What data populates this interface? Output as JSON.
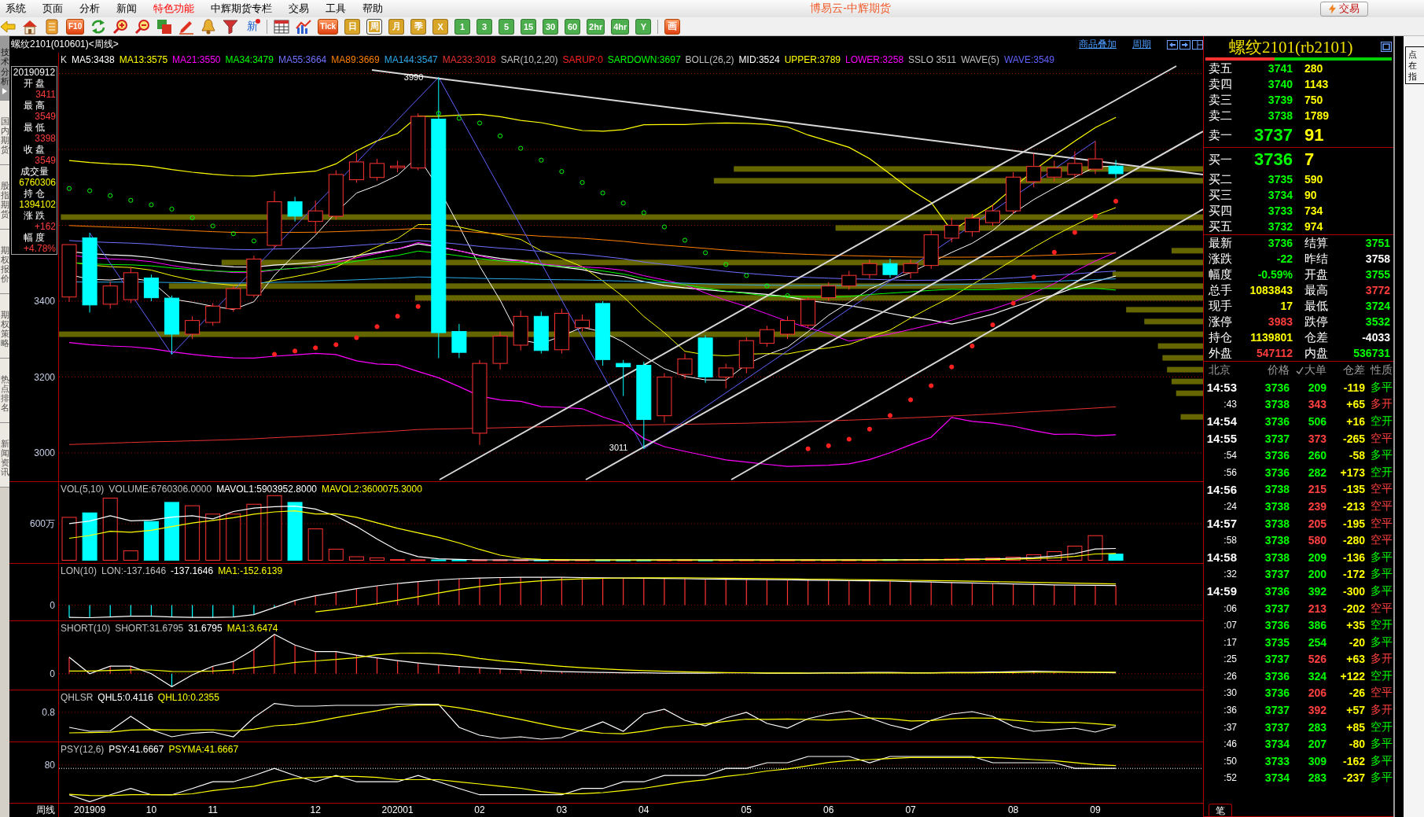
{
  "window": {
    "title": "博易云-中辉期货"
  },
  "menu": [
    {
      "label": "系统",
      "highlighted": false
    },
    {
      "label": "页面",
      "highlighted": false
    },
    {
      "label": "分析",
      "highlighted": false
    },
    {
      "label": "新闻",
      "highlighted": false
    },
    {
      "label": "特色功能",
      "highlighted": true
    },
    {
      "label": "中辉期货专栏",
      "highlighted": false
    },
    {
      "label": "交易",
      "highlighted": false
    },
    {
      "label": "工具",
      "highlighted": false
    },
    {
      "label": "帮助",
      "highlighted": false
    }
  ],
  "trade_button": {
    "label": "交易"
  },
  "toolbar": {
    "f10": "F10",
    "news": "新",
    "tick": "Tick",
    "draw": "画",
    "periods": [
      {
        "label": "日",
        "selected": false,
        "color": "#d8a528"
      },
      {
        "label": "周",
        "selected": true,
        "color": "#d8a528"
      },
      {
        "label": "月",
        "selected": false,
        "color": "#d8a528"
      },
      {
        "label": "季",
        "selected": false,
        "color": "#d8a528"
      },
      {
        "label": "X",
        "selected": false,
        "color": "#d8a528"
      },
      {
        "label": "1",
        "selected": false,
        "color": "#4cae4c"
      },
      {
        "label": "3",
        "selected": false,
        "color": "#4cae4c"
      },
      {
        "label": "5",
        "selected": false,
        "color": "#4cae4c"
      },
      {
        "label": "15",
        "selected": false,
        "color": "#4cae4c"
      },
      {
        "label": "30",
        "selected": false,
        "color": "#4cae4c"
      },
      {
        "label": "60",
        "selected": false,
        "color": "#4cae4c"
      },
      {
        "label": "2hr",
        "selected": false,
        "color": "#4cae4c"
      },
      {
        "label": "4hr",
        "selected": false,
        "color": "#4cae4c"
      },
      {
        "label": "Y",
        "selected": false,
        "color": "#4cae4c"
      }
    ]
  },
  "side_tabs": [
    {
      "label": "技术分析",
      "selected": true
    },
    {
      "label": "国内期货",
      "selected": false
    },
    {
      "label": "股指期货",
      "selected": false
    },
    {
      "label": "期权报价",
      "selected": false
    },
    {
      "label": "期权策略",
      "selected": false
    },
    {
      "label": "热点排名",
      "selected": false
    },
    {
      "label": "新闻资讯",
      "selected": false
    }
  ],
  "chart_header": {
    "title": "螺纹2101(010601)<周线>",
    "links": [
      "商品叠加",
      "周期"
    ]
  },
  "main_chart": {
    "legend": [
      {
        "text": "K",
        "color": "#e0e0e0"
      },
      {
        "text": "MA5:3438",
        "color": "#ffffff"
      },
      {
        "text": "MA13:3575",
        "color": "#ffff00"
      },
      {
        "text": "MA21:3550",
        "color": "#ff00ff"
      },
      {
        "text": "MA34:3479",
        "color": "#00ff00"
      },
      {
        "text": "MA55:3664",
        "color": "#7070ff"
      },
      {
        "text": "MA89:3669",
        "color": "#ff8000"
      },
      {
        "text": "MA144:3547",
        "color": "#2ca8e8"
      },
      {
        "text": "MA233:3018",
        "color": "#e83030"
      },
      {
        "text": "SAR(10,2,20)",
        "color": "#c0c0c0"
      },
      {
        "text": "SARUP:0",
        "color": "#ff2020"
      },
      {
        "text": "SARDOWN:3697",
        "color": "#00ff00"
      },
      {
        "text": "BOLL(26,2)",
        "color": "#c0c0c0"
      },
      {
        "text": "MID:3524",
        "color": "#ffffff"
      },
      {
        "text": "UPPER:3789",
        "color": "#ffff00"
      },
      {
        "text": "LOWER:3258",
        "color": "#ff00ff"
      },
      {
        "text": "SSLO 3511",
        "color": "#c0c0c0"
      },
      {
        "text": "WAVE(5)",
        "color": "#c0c0c0"
      },
      {
        "text": "WAVE:3549",
        "color": "#6060ff"
      }
    ],
    "info": {
      "date": "20190912",
      "fields": [
        {
          "label": "开 盘",
          "value": "3411",
          "color": "#ff3c3c"
        },
        {
          "label": "最 高",
          "value": "3549",
          "color": "#ff3c3c"
        },
        {
          "label": "最 低",
          "value": "3398",
          "color": "#ff3c3c"
        },
        {
          "label": "收 盘",
          "value": "3549",
          "color": "#ff3c3c"
        },
        {
          "label": "成交量",
          "value": "6760306",
          "color": "#ffff00"
        },
        {
          "label": "持 仓",
          "value": "1394102",
          "color": "#ffff00"
        },
        {
          "label": "涨 跌",
          "value": "+162",
          "color": "#ff3c3c"
        },
        {
          "label": "幅 度",
          "value": "+4.78%",
          "color": "#ff3c3c"
        }
      ]
    },
    "y_labels": [
      "3400",
      "3200",
      "3000"
    ],
    "high_mark": "3990",
    "low_mark": "3011"
  },
  "indicator_panes": [
    {
      "kind": "volume",
      "axis_label": "600万",
      "legend": [
        {
          "text": "VOL(5,10)",
          "color": "#c0c0c0"
        },
        {
          "text": "VOLUME:6760306.0000",
          "color": "#c0c0c0"
        },
        {
          "text": "MAVOL1:5903952.8000",
          "color": "#ffffff"
        },
        {
          "text": "MAVOL2:3600075.3000",
          "color": "#ffff00"
        }
      ]
    },
    {
      "kind": "lon",
      "axis_label": "0",
      "legend": [
        {
          "text": "LON(10)",
          "color": "#c0c0c0"
        },
        {
          "text": "LON:-137.1646",
          "color": "#c0c0c0"
        },
        {
          "text": "-137.1646",
          "color": "#ffffff"
        },
        {
          "text": "MA1:-152.6139",
          "color": "#ffff00"
        }
      ]
    },
    {
      "kind": "short",
      "axis_label": "0",
      "legend": [
        {
          "text": "SHORT(10)",
          "color": "#c0c0c0"
        },
        {
          "text": "SHORT:31.6795",
          "color": "#c0c0c0"
        },
        {
          "text": "31.6795",
          "color": "#ffffff"
        },
        {
          "text": "MA1:3.6474",
          "color": "#ffff00"
        }
      ]
    },
    {
      "kind": "qhlsr",
      "axis_label": "0.8",
      "legend": [
        {
          "text": "QHLSR",
          "color": "#c0c0c0"
        },
        {
          "text": "QHL5:0.4116",
          "color": "#ffffff"
        },
        {
          "text": "QHL10:0.2355",
          "color": "#ffff00"
        }
      ]
    },
    {
      "kind": "psy",
      "axis_label": "80",
      "legend": [
        {
          "text": "PSY(12,6)",
          "color": "#c0c0c0"
        },
        {
          "text": "PSY:41.6667",
          "color": "#ffffff"
        },
        {
          "text": "PSYMA:41.6667",
          "color": "#ffff00"
        }
      ]
    }
  ],
  "x_axis": {
    "label": "周线",
    "ticks": [
      "201909",
      "10",
      "11",
      "12",
      "202001",
      "02",
      "03",
      "04",
      "05",
      "06",
      "07",
      "08",
      "09"
    ]
  },
  "quote": {
    "title": "螺纹2101(rb2101)",
    "balance": {
      "level": 0.37
    },
    "asks": [
      {
        "label": "卖五",
        "price": "3741",
        "volume": "280",
        "kind": "level"
      },
      {
        "label": "卖四",
        "price": "3740",
        "volume": "1143",
        "kind": "level"
      },
      {
        "label": "卖三",
        "price": "3739",
        "volume": "750",
        "kind": "level"
      },
      {
        "label": "卖二",
        "price": "3738",
        "volume": "1789",
        "kind": "level"
      },
      {
        "label": "卖一",
        "price": "3737",
        "volume": "91",
        "kind": "best"
      }
    ],
    "bids": [
      {
        "label": "买一",
        "price": "3736",
        "volume": "7",
        "kind": "best"
      },
      {
        "label": "买二",
        "price": "3735",
        "volume": "590",
        "kind": "level"
      },
      {
        "label": "买三",
        "price": "3734",
        "volume": "90",
        "kind": "level"
      },
      {
        "label": "买四",
        "price": "3733",
        "volume": "734",
        "kind": "level"
      },
      {
        "label": "买五",
        "price": "3732",
        "volume": "974",
        "kind": "level"
      }
    ],
    "stats": [
      {
        "left": {
          "label": "最新",
          "value": "3736",
          "color": "#00ff00"
        },
        "right": {
          "label": "结算",
          "value": "3751",
          "color": "#00ff00"
        }
      },
      {
        "left": {
          "label": "涨跌",
          "value": "-22",
          "color": "#00ff00"
        },
        "right": {
          "label": "昨结",
          "value": "3758",
          "color": "#ffffff"
        }
      },
      {
        "left": {
          "label": "幅度",
          "value": "-0.59%",
          "color": "#00ff00"
        },
        "right": {
          "label": "开盘",
          "value": "3755",
          "color": "#00ff00"
        }
      },
      {
        "left": {
          "label": "总手",
          "value": "1083843",
          "color": "#ffff00"
        },
        "right": {
          "label": "最高",
          "value": "3772",
          "color": "#ff3c3c"
        }
      },
      {
        "left": {
          "label": "现手",
          "value": "17",
          "color": "#ffff00"
        },
        "right": {
          "label": "最低",
          "value": "3724",
          "color": "#00ff00"
        }
      },
      {
        "left": {
          "label": "涨停",
          "value": "3983",
          "color": "#ff3c3c"
        },
        "right": {
          "label": "跌停",
          "value": "3532",
          "color": "#00ff00"
        }
      },
      {
        "left": {
          "label": "持仓",
          "value": "1139801",
          "color": "#ffff00"
        },
        "right": {
          "label": "仓差",
          "value": "-4033",
          "color": "#ffffff"
        }
      },
      {
        "left": {
          "label": "外盘",
          "value": "547112",
          "color": "#ff3c3c"
        },
        "right": {
          "label": "内盘",
          "value": "536731",
          "color": "#00ff00"
        }
      }
    ],
    "ticks": {
      "header": [
        "北京",
        "价格",
        "大单",
        "仓差",
        "性质"
      ],
      "rows": [
        {
          "time": "14:53",
          "kind": "minute",
          "price": "3736",
          "volume": "209",
          "change": "-119",
          "type": "多平",
          "color": "#00ff00"
        },
        {
          "time": ":43",
          "kind": "second",
          "price": "3738",
          "volume": "343",
          "change": "+65",
          "type": "多开",
          "color": "#ff4040"
        },
        {
          "time": "14:54",
          "kind": "minute",
          "price": "3736",
          "volume": "506",
          "change": "+16",
          "type": "空开",
          "color": "#00ff00"
        },
        {
          "time": "14:55",
          "kind": "minute",
          "price": "3737",
          "volume": "373",
          "change": "-265",
          "type": "空平",
          "color": "#ff4040"
        },
        {
          "time": ":54",
          "kind": "second",
          "price": "3736",
          "volume": "260",
          "change": "-58",
          "type": "多平",
          "color": "#00ff00"
        },
        {
          "time": ":56",
          "kind": "second",
          "price": "3736",
          "volume": "282",
          "change": "+173",
          "type": "空开",
          "color": "#00ff00"
        },
        {
          "time": "14:56",
          "kind": "minute",
          "price": "3738",
          "volume": "215",
          "change": "-135",
          "type": "空平",
          "color": "#ff4040"
        },
        {
          "time": ":24",
          "kind": "second",
          "price": "3738",
          "volume": "239",
          "change": "-213",
          "type": "空平",
          "color": "#ff4040"
        },
        {
          "time": "14:57",
          "kind": "minute",
          "price": "3738",
          "volume": "205",
          "change": "-195",
          "type": "空平",
          "color": "#ff4040"
        },
        {
          "time": ":58",
          "kind": "second",
          "price": "3738",
          "volume": "580",
          "change": "-280",
          "type": "空平",
          "color": "#ff4040"
        },
        {
          "time": "14:58",
          "kind": "minute",
          "price": "3738",
          "volume": "209",
          "change": "-136",
          "type": "多平",
          "color": "#00ff00"
        },
        {
          "time": ":32",
          "kind": "second",
          "price": "3737",
          "volume": "200",
          "change": "-172",
          "type": "多平",
          "color": "#00ff00"
        },
        {
          "time": "14:59",
          "kind": "minute",
          "price": "3736",
          "volume": "392",
          "change": "-300",
          "type": "多平",
          "color": "#00ff00"
        },
        {
          "time": ":06",
          "kind": "second",
          "price": "3737",
          "volume": "213",
          "change": "-202",
          "type": "空平",
          "color": "#ff4040"
        },
        {
          "time": ":07",
          "kind": "second",
          "price": "3736",
          "volume": "386",
          "change": "+35",
          "type": "空开",
          "color": "#00ff00"
        },
        {
          "time": ":17",
          "kind": "second",
          "price": "3735",
          "volume": "254",
          "change": "-20",
          "type": "多平",
          "color": "#00ff00"
        },
        {
          "time": ":25",
          "kind": "second",
          "price": "3737",
          "volume": "526",
          "change": "+63",
          "type": "多开",
          "color": "#ff4040"
        },
        {
          "time": ":26",
          "kind": "second",
          "price": "3736",
          "volume": "324",
          "change": "+122",
          "type": "空开",
          "color": "#00ff00"
        },
        {
          "time": ":30",
          "kind": "second",
          "price": "3736",
          "volume": "206",
          "change": "-26",
          "type": "空平",
          "color": "#ff4040"
        },
        {
          "time": ":36",
          "kind": "second",
          "price": "3737",
          "volume": "392",
          "change": "+57",
          "type": "多开",
          "color": "#ff4040"
        },
        {
          "time": ":37",
          "kind": "second",
          "price": "3737",
          "volume": "283",
          "change": "+85",
          "type": "空开",
          "color": "#00ff00"
        },
        {
          "time": ":46",
          "kind": "second",
          "price": "3734",
          "volume": "207",
          "change": "-80",
          "type": "多平",
          "color": "#00ff00"
        },
        {
          "time": ":50",
          "kind": "second",
          "price": "3733",
          "volume": "309",
          "change": "-162",
          "type": "多平",
          "color": "#00ff00"
        },
        {
          "time": ":52",
          "kind": "second",
          "price": "3734",
          "volume": "283",
          "change": "-237",
          "type": "多平",
          "color": "#00ff00"
        }
      ]
    },
    "tabs": [
      {
        "label": "笔",
        "selected": true
      }
    ]
  },
  "hint": {
    "lines": [
      "点",
      "在",
      "指"
    ]
  }
}
